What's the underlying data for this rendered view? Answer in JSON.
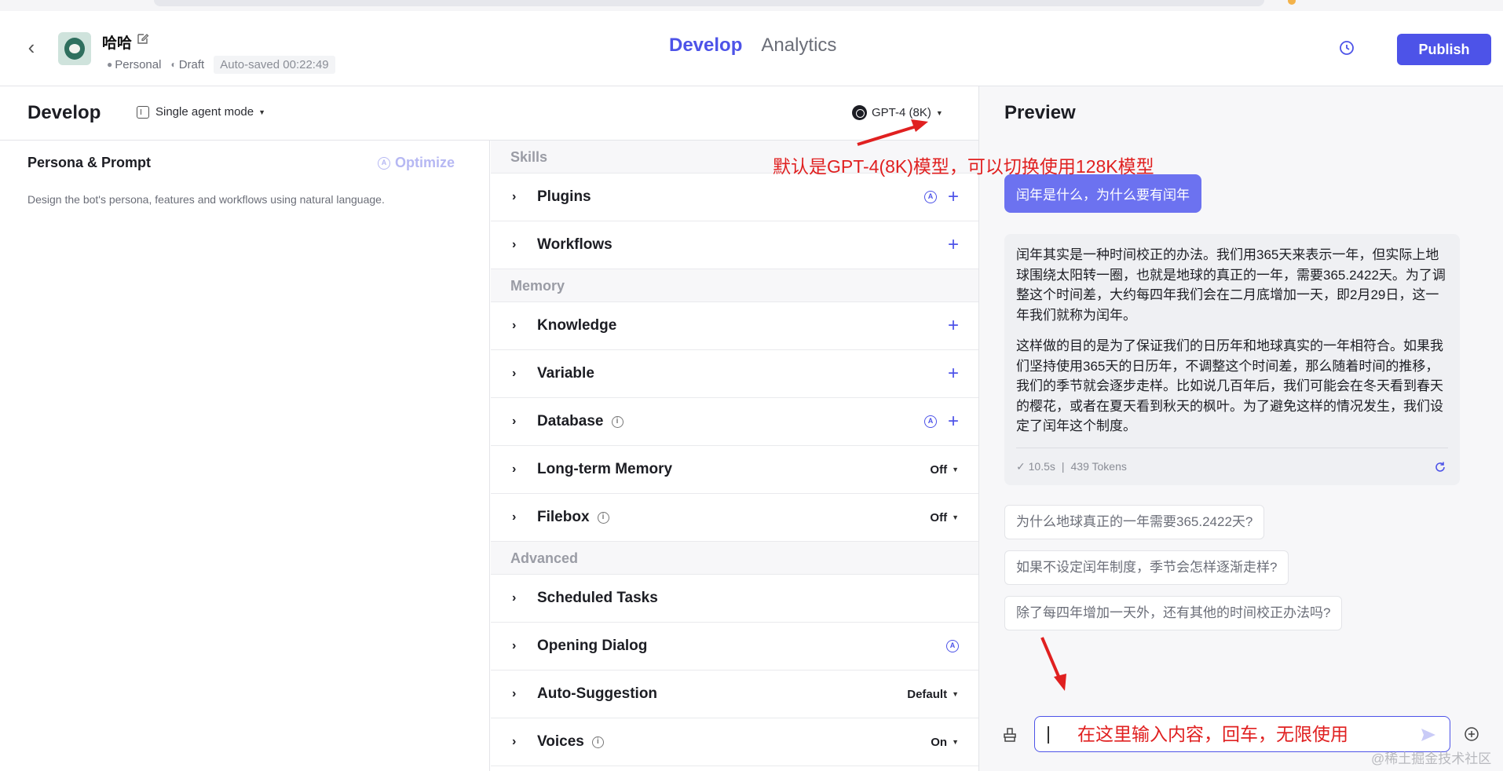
{
  "header": {
    "bot_name": "哈哈",
    "meta": {
      "owner": "Personal",
      "status": "Draft",
      "autosave": "Auto-saved 00:22:49"
    },
    "tabs": [
      {
        "label": "Develop",
        "active": true
      },
      {
        "label": "Analytics",
        "active": false
      }
    ],
    "publish_label": "Publish"
  },
  "subbar": {
    "title": "Develop",
    "mode": "Single agent mode",
    "model": "GPT-4 (8K)"
  },
  "persona": {
    "title": "Persona & Prompt",
    "optimize_label": "Optimize",
    "description": "Design the bot's persona, features and workflows using natural language."
  },
  "sections": {
    "skills": "Skills",
    "memory": "Memory",
    "advanced": "Advanced"
  },
  "rows": {
    "plugins": "Plugins",
    "workflows": "Workflows",
    "knowledge": "Knowledge",
    "variable": "Variable",
    "database": "Database",
    "long_term_memory": {
      "label": "Long-term Memory",
      "value": "Off"
    },
    "filebox": {
      "label": "Filebox",
      "value": "Off"
    },
    "scheduled_tasks": "Scheduled Tasks",
    "opening_dialog": "Opening Dialog",
    "auto_suggestion": {
      "label": "Auto-Suggestion",
      "value": "Default"
    },
    "voices": {
      "label": "Voices",
      "value": "On"
    }
  },
  "preview": {
    "title": "Preview",
    "user_message": "闰年是什么，为什么要有闰年",
    "bot_paragraph_1": "闰年其实是一种时间校正的办法。我们用365天来表示一年，但实际上地球围绕太阳转一圈，也就是地球的真正的一年，需要365.2422天。为了调整这个时间差，大约每四年我们会在二月底增加一天，即2月29日，这一年我们就称为闰年。",
    "bot_paragraph_2": "这样做的目的是为了保证我们的日历年和地球真实的一年相符合。如果我们坚持使用365天的日历年，不调整这个时间差，那么随着时间的推移，我们的季节就会逐步走样。比如说几百年后，我们可能会在冬天看到春天的樱花，或者在夏天看到秋天的枫叶。为了避免这样的情况发生，我们设定了闰年这个制度。",
    "time": "10.5s",
    "tokens": "439 Tokens",
    "suggestions": [
      "为什么地球真正的一年需要365.2422天?",
      "如果不设定闰年制度，季节会怎样逐渐走样?",
      "除了每四年增加一天外，还有其他的时间校正办法吗?"
    ]
  },
  "annotations": {
    "model_note": "默认是GPT-4(8K)模型，可以切换使用128K模型",
    "input_note": "在这里输入内容，回车，无限使用"
  },
  "watermark": "@稀土掘金技术社区",
  "colors": {
    "accent": "#4d53e8",
    "annotation": "#e02020",
    "user_bubble": "#6c72f0"
  }
}
